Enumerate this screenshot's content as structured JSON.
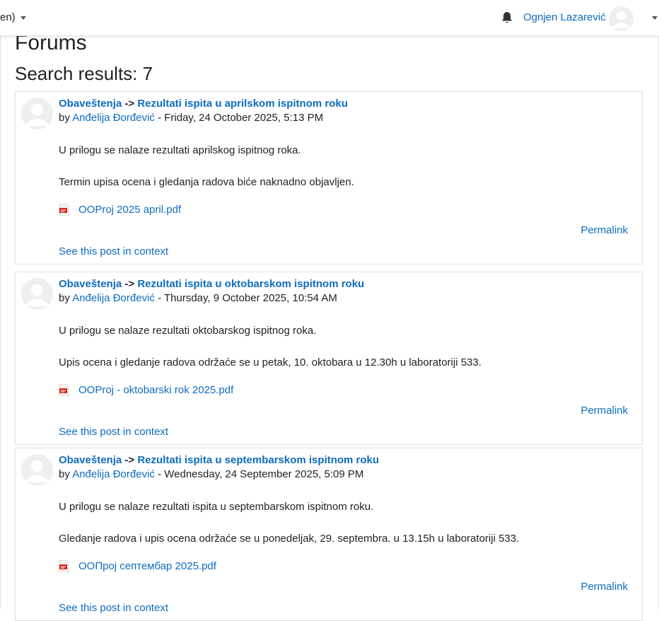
{
  "navbar": {
    "language_label": "en)",
    "user_name": "Ognjen Lazarević"
  },
  "page": {
    "title": "Forums",
    "results_heading": "Search results: 7"
  },
  "posts": [
    {
      "forum": "Obaveštenja",
      "separator": "->",
      "subject": "Rezultati ispita u aprilskom ispitnom roku",
      "by": "by",
      "author": "Anđelija Đorđević",
      "date": "- Friday, 24 October 2025, 5:13 PM",
      "paragraph1": "U prilogu se nalaze rezultati aprilskog ispitnog roka.",
      "paragraph2": "Termin upisa ocena i gledanja radova biće naknadno objavljen.",
      "attachment": "OOProj 2025 april.pdf",
      "permalink": "Permalink",
      "context": "See this post in context"
    },
    {
      "forum": "Obaveštenja",
      "separator": "->",
      "subject": "Rezultati ispita u oktobarskom ispitnom roku",
      "by": "by",
      "author": "Anđelija Đorđević",
      "date": "- Thursday, 9 October 2025, 10:54 AM",
      "paragraph1": "U prilogu se nalaze rezultati oktobarskog ispitnog roka.",
      "paragraph2": "Upis ocena i gledanje radova održaće se u petak, 10. oktobara u 12.30h u laboratoriji 533.",
      "attachment": "OOProj - oktobarski rok 2025.pdf",
      "permalink": "Permalink",
      "context": "See this post in context"
    },
    {
      "forum": "Obaveštenja",
      "separator": "->",
      "subject": "Rezultati ispita u septembarskom ispitnom roku",
      "by": "by",
      "author": "Anđelija Đorđević",
      "date": "- Wednesday, 24 September 2025, 5:09 PM",
      "paragraph1": "U prilogu se nalaze rezultati ispita u septembarskom ispitnom roku.",
      "paragraph2": "Gledanje radova i upis ocena održaće se u ponedeljak, 29. septembra. u 13.15h u laboratoriji 533.",
      "attachment": "OOПрој септембар 2025.pdf",
      "permalink": "Permalink",
      "context": "See this post in context"
    }
  ],
  "icons": {
    "bell": "bell-icon",
    "avatar": "user-avatar-icon",
    "pdf": "pdf-file-icon",
    "caret": "caret-down-icon"
  },
  "colors": {
    "link": "#0f6cbf",
    "text": "#1d2125",
    "border": "#dee2e6",
    "pdf_red": "#d9251c"
  }
}
